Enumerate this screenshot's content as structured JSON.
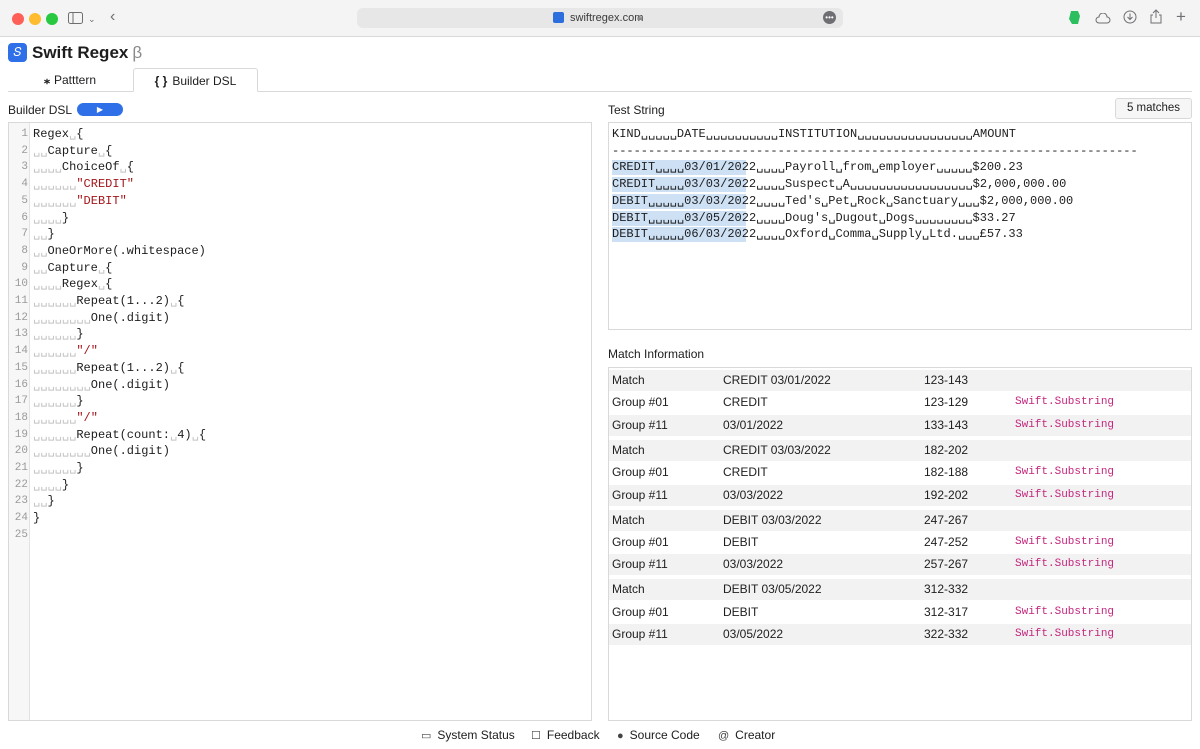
{
  "browser": {
    "url": "swiftregex.com",
    "more_glyph": "•••",
    "icons": [
      "sidebar-icon",
      "back-icon",
      "evernote-icon",
      "icloud-icon",
      "download-icon",
      "share-icon",
      "new-tab-icon"
    ]
  },
  "app": {
    "title": "Swift Regex",
    "beta": "β"
  },
  "tabs": [
    {
      "label": "Patttern",
      "icon": "pattern-icon",
      "glyph": "⁎"
    },
    {
      "label": "Builder DSL",
      "icon": "braces-icon",
      "glyph": "{ }"
    }
  ],
  "builder": {
    "label": "Builder DSL",
    "run_glyph": "▶",
    "lines": [
      {
        "n": "1",
        "segs": [
          [
            "t",
            "Regex"
          ],
          [
            "w",
            "␣"
          ],
          [
            "t",
            "{"
          ]
        ]
      },
      {
        "n": "2",
        "segs": [
          [
            "w",
            "␣␣"
          ],
          [
            "t",
            "Capture"
          ],
          [
            "w",
            "␣"
          ],
          [
            "t",
            "{"
          ]
        ]
      },
      {
        "n": "3",
        "segs": [
          [
            "w",
            "␣␣␣␣"
          ],
          [
            "t",
            "ChoiceOf"
          ],
          [
            "w",
            "␣"
          ],
          [
            "t",
            "{"
          ]
        ]
      },
      {
        "n": "4",
        "segs": [
          [
            "w",
            "␣␣␣␣␣␣"
          ],
          [
            "s",
            "\"CREDIT\""
          ]
        ]
      },
      {
        "n": "5",
        "segs": [
          [
            "w",
            "␣␣␣␣␣␣"
          ],
          [
            "s",
            "\"DEBIT\""
          ]
        ]
      },
      {
        "n": "6",
        "segs": [
          [
            "w",
            "␣␣␣␣"
          ],
          [
            "t",
            "}"
          ]
        ]
      },
      {
        "n": "7",
        "segs": [
          [
            "w",
            "␣␣"
          ],
          [
            "t",
            "}"
          ]
        ]
      },
      {
        "n": "8",
        "segs": [
          [
            "w",
            "␣␣"
          ],
          [
            "t",
            "OneOrMore(.whitespace)"
          ]
        ]
      },
      {
        "n": "9",
        "segs": [
          [
            "w",
            "␣␣"
          ],
          [
            "t",
            "Capture"
          ],
          [
            "w",
            "␣"
          ],
          [
            "t",
            "{"
          ]
        ]
      },
      {
        "n": "10",
        "segs": [
          [
            "w",
            "␣␣␣␣"
          ],
          [
            "t",
            "Regex"
          ],
          [
            "w",
            "␣"
          ],
          [
            "t",
            "{"
          ]
        ]
      },
      {
        "n": "11",
        "segs": [
          [
            "w",
            "␣␣␣␣␣␣"
          ],
          [
            "t",
            "Repeat(1...2)"
          ],
          [
            "w",
            "␣"
          ],
          [
            "t",
            "{"
          ]
        ]
      },
      {
        "n": "12",
        "segs": [
          [
            "w",
            "␣␣␣␣␣␣␣␣"
          ],
          [
            "t",
            "One(.digit)"
          ]
        ]
      },
      {
        "n": "13",
        "segs": [
          [
            "w",
            "␣␣␣␣␣␣"
          ],
          [
            "t",
            "}"
          ]
        ]
      },
      {
        "n": "14",
        "segs": [
          [
            "w",
            "␣␣␣␣␣␣"
          ],
          [
            "s",
            "\"/\""
          ]
        ]
      },
      {
        "n": "15",
        "segs": [
          [
            "w",
            "␣␣␣␣␣␣"
          ],
          [
            "t",
            "Repeat(1...2)"
          ],
          [
            "w",
            "␣"
          ],
          [
            "t",
            "{"
          ]
        ]
      },
      {
        "n": "16",
        "segs": [
          [
            "w",
            "␣␣␣␣␣␣␣␣"
          ],
          [
            "t",
            "One(.digit)"
          ]
        ]
      },
      {
        "n": "17",
        "segs": [
          [
            "w",
            "␣␣␣␣␣␣"
          ],
          [
            "t",
            "}"
          ]
        ]
      },
      {
        "n": "18",
        "segs": [
          [
            "w",
            "␣␣␣␣␣␣"
          ],
          [
            "s",
            "\"/\""
          ]
        ]
      },
      {
        "n": "19",
        "segs": [
          [
            "w",
            "␣␣␣␣␣␣"
          ],
          [
            "t",
            "Repeat(count:"
          ],
          [
            "w",
            "␣"
          ],
          [
            "t",
            "4)"
          ],
          [
            "w",
            "␣"
          ],
          [
            "t",
            "{"
          ]
        ]
      },
      {
        "n": "20",
        "segs": [
          [
            "w",
            "␣␣␣␣␣␣␣␣"
          ],
          [
            "t",
            "One(.digit)"
          ]
        ]
      },
      {
        "n": "21",
        "segs": [
          [
            "w",
            "␣␣␣␣␣␣"
          ],
          [
            "t",
            "}"
          ]
        ]
      },
      {
        "n": "22",
        "segs": [
          [
            "w",
            "␣␣␣␣"
          ],
          [
            "t",
            "}"
          ]
        ]
      },
      {
        "n": "23",
        "segs": [
          [
            "w",
            "␣␣"
          ],
          [
            "t",
            "}"
          ]
        ]
      },
      {
        "n": "24",
        "segs": [
          [
            "t",
            "}"
          ]
        ]
      },
      {
        "n": "25",
        "segs": []
      }
    ]
  },
  "test": {
    "label": "Test String",
    "match_count": "5 matches",
    "lines": [
      "KIND␣␣␣␣␣DATE␣␣␣␣␣␣␣␣␣␣INSTITUTION␣␣␣␣␣␣␣␣␣␣␣␣␣␣␣␣AMOUNT",
      "-------------------------------------------------------------------------",
      "CREDIT␣␣␣␣03/01/2022␣␣␣␣Payroll␣from␣employer␣␣␣␣␣$200.23",
      "CREDIT␣␣␣␣03/03/2022␣␣␣␣Suspect␣A␣␣␣␣␣␣␣␣␣␣␣␣␣␣␣␣␣$2,000,000.00",
      "DEBIT␣␣␣␣␣03/03/2022␣␣␣␣Ted's␣Pet␣Rock␣Sanctuary␣␣␣$2,000,000.00",
      "DEBIT␣␣␣␣␣03/05/2022␣␣␣␣Doug's␣Dugout␣Dogs␣␣␣␣␣␣␣␣$33.27",
      "DEBIT␣␣␣␣␣06/03/2022␣␣␣␣Oxford␣Comma␣Supply␣Ltd.␣␣␣£57.33"
    ]
  },
  "match_info": {
    "label": "Match Information",
    "rows": [
      {
        "c1": "Match",
        "c2": "CREDIT 03/01/2022",
        "c3": "123-143",
        "c4": ""
      },
      {
        "c1": "Group #01",
        "c2": "CREDIT",
        "c3": "123-129",
        "c4": "Swift.Substring"
      },
      {
        "c1": "Group #11",
        "c2": "03/01/2022",
        "c3": "133-143",
        "c4": "Swift.Substring"
      },
      {
        "c1": "Match",
        "c2": "CREDIT 03/03/2022",
        "c3": "182-202",
        "c4": ""
      },
      {
        "c1": "Group #01",
        "c2": "CREDIT",
        "c3": "182-188",
        "c4": "Swift.Substring"
      },
      {
        "c1": "Group #11",
        "c2": "03/03/2022",
        "c3": "192-202",
        "c4": "Swift.Substring"
      },
      {
        "c1": "Match",
        "c2": "DEBIT 03/03/2022",
        "c3": "247-267",
        "c4": ""
      },
      {
        "c1": "Group #01",
        "c2": "DEBIT",
        "c3": "247-252",
        "c4": "Swift.Substring"
      },
      {
        "c1": "Group #11",
        "c2": "03/03/2022",
        "c3": "257-267",
        "c4": "Swift.Substring"
      },
      {
        "c1": "Match",
        "c2": "DEBIT 03/05/2022",
        "c3": "312-332",
        "c4": ""
      },
      {
        "c1": "Group #01",
        "c2": "DEBIT",
        "c3": "312-317",
        "c4": "Swift.Substring"
      },
      {
        "c1": "Group #11",
        "c2": "03/05/2022",
        "c3": "322-332",
        "c4": "Swift.Substring"
      }
    ]
  },
  "footer": [
    {
      "label": "System Status",
      "icon": "status-icon",
      "glyph": "▭"
    },
    {
      "label": "Feedback",
      "icon": "feedback-icon",
      "glyph": "☐"
    },
    {
      "label": "Source Code",
      "icon": "github-icon",
      "glyph": "●"
    },
    {
      "label": "Creator",
      "icon": "at-icon",
      "glyph": "@"
    }
  ],
  "colors": {
    "accent": "#2f6fe8",
    "string": "#a3151a",
    "type": "#c4267d",
    "highlight": "#cde0f4"
  }
}
